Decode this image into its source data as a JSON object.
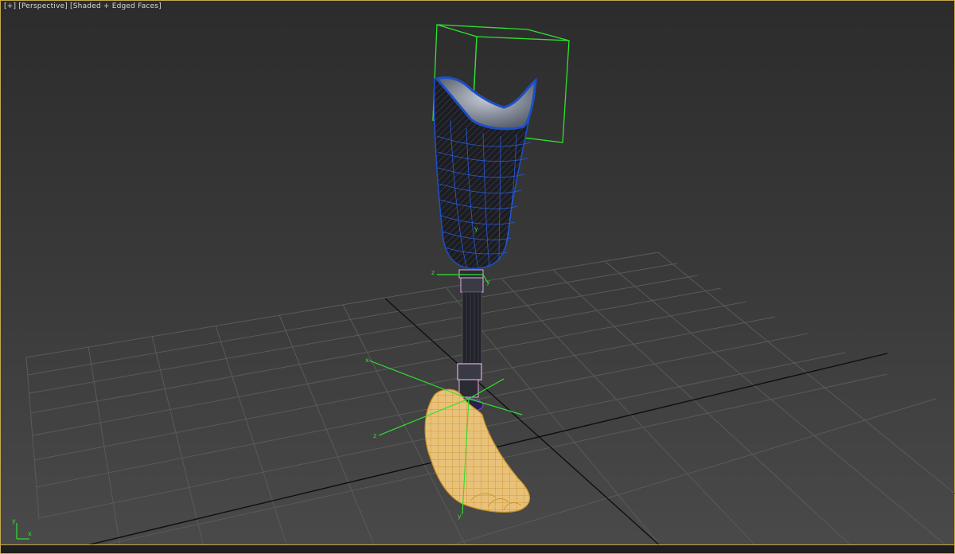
{
  "viewport": {
    "menu_label": "[+]",
    "view_label": "[Perspective]",
    "shading_label": "[Shaded + Edged Faces]"
  },
  "gizmo_labels": {
    "socket_y": "y",
    "pylon_z": "z",
    "pylon_y": "y",
    "ankle_x": "x",
    "ankle_z": "z",
    "foot_y": "y",
    "corner_y": "y",
    "corner_x": "x"
  },
  "colors": {
    "grid": "#5a5a5a",
    "grid_axis": "#0f0f0f",
    "selection_box": "#2fe22f",
    "socket_wire": "#2a5cd8",
    "socket_fill": "#1c1d22",
    "socket_rim": "#1d4fc5",
    "socket_inner": "#8f97a3",
    "pylon_ring": "#e6a8e6",
    "foot_fill": "#e8c27a",
    "foot_wire": "#c98f27",
    "gizmo": "#2fe22f",
    "frame": "#c8a84a"
  },
  "icons": [
    "transform-gizmo-icon",
    "world-axis-icon"
  ]
}
